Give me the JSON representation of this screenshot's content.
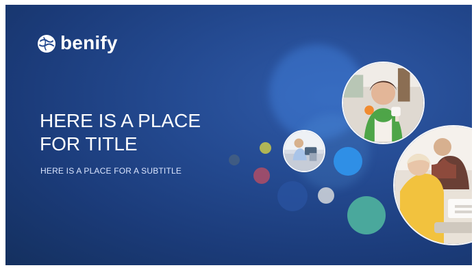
{
  "brand": {
    "name": "benify",
    "logo_icon": "globe-icon"
  },
  "slide": {
    "title_line_1": "HERE IS A PLACE",
    "title_line_2": "FOR TITLE",
    "subtitle": "HERE IS A PLACE FOR A SUBTITLE"
  },
  "colors": {
    "background": "#244a91",
    "accent_blue": "#2f8fe6",
    "accent_green": "#4aa89c",
    "accent_yellow": "#c9c84a",
    "accent_red": "#b84d63",
    "accent_gray": "#c8cdd6"
  },
  "images": {
    "portrait_small": "person-reading-icon",
    "portrait_top": "woman-smiling-icon",
    "portrait_large": "team-meeting-icon"
  }
}
